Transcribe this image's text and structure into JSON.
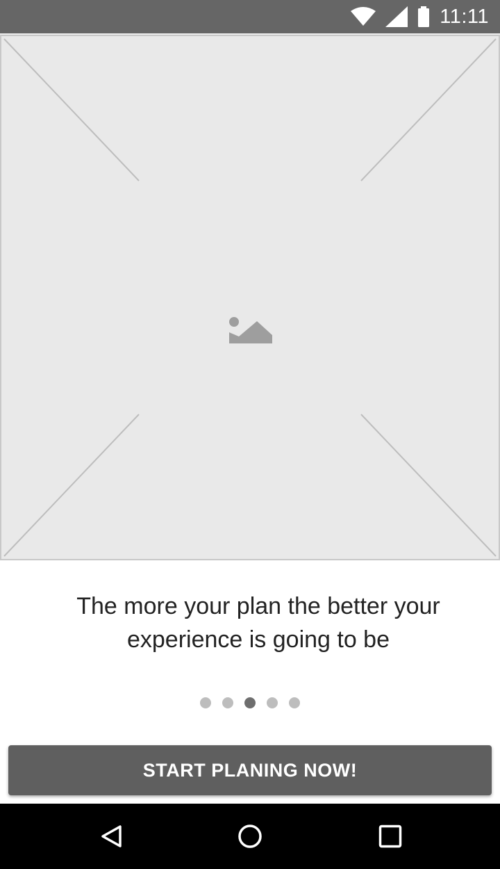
{
  "status_bar": {
    "time": "11:11",
    "icons": [
      "wifi-icon",
      "signal-icon",
      "battery-icon"
    ]
  },
  "hero": {
    "icon": "image-placeholder-icon"
  },
  "message": {
    "line1": "The more your plan the better your",
    "line2": "experience is going to be"
  },
  "pager": {
    "count": 5,
    "active_index": 2
  },
  "cta": {
    "label": "START PLANING NOW!"
  },
  "nav_bar": {
    "icons": [
      "back-icon",
      "home-icon",
      "recents-icon"
    ]
  },
  "colors": {
    "status_bar": "#666666",
    "button": "#5f5f5f",
    "placeholder": "#e9e9e9",
    "dot_active": "#6e6e6e",
    "dot_inactive": "#bdbdbd"
  }
}
